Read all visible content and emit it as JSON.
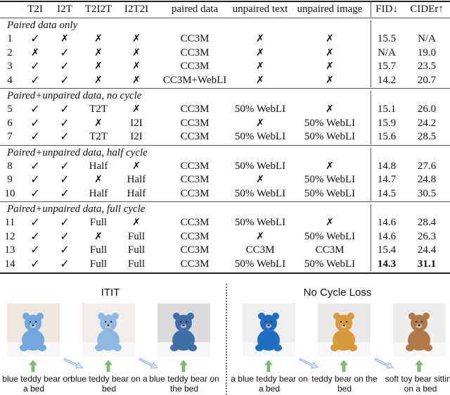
{
  "table": {
    "headers": [
      "",
      "T2I",
      "I2T",
      "T2I2T",
      "I2T2I",
      "paired data",
      "unpaired text",
      "unpaired image",
      "FID↓",
      "CIDEr↑"
    ],
    "sections": [
      {
        "title": "Paired data only",
        "rows": [
          {
            "id": "1",
            "t2i": "✓",
            "i2t": "✗",
            "t2i2t": "✗",
            "i2t2i": "✗",
            "paired": "CC3M",
            "unpaired_text": "✗",
            "unpaired_image": "✗",
            "fid": "15.5",
            "cider": "N/A"
          },
          {
            "id": "2",
            "t2i": "✗",
            "i2t": "✓",
            "t2i2t": "✗",
            "i2t2i": "✗",
            "paired": "CC3M",
            "unpaired_text": "✗",
            "unpaired_image": "✗",
            "fid": "N/A",
            "cider": "19.0"
          },
          {
            "id": "3",
            "t2i": "✓",
            "i2t": "✓",
            "t2i2t": "✗",
            "i2t2i": "✗",
            "paired": "CC3M",
            "unpaired_text": "✗",
            "unpaired_image": "✗",
            "fid": "15.7",
            "cider": "23.5"
          },
          {
            "id": "4",
            "t2i": "✓",
            "i2t": "✓",
            "t2i2t": "✗",
            "i2t2i": "✗",
            "paired": "CC3M+WebLI",
            "unpaired_text": "✗",
            "unpaired_image": "✗",
            "fid": "14.2",
            "cider": "20.7"
          }
        ]
      },
      {
        "title": "Paired+unpaired data, no cycle",
        "rows": [
          {
            "id": "5",
            "t2i": "✓",
            "i2t": "✓",
            "t2i2t": "T2T",
            "i2t2i": "✗",
            "paired": "CC3M",
            "unpaired_text": "50% WebLI",
            "unpaired_image": "✗",
            "fid": "15.1",
            "cider": "26.0"
          },
          {
            "id": "6",
            "t2i": "✓",
            "i2t": "✓",
            "t2i2t": "✗",
            "i2t2i": "I2I",
            "paired": "CC3M",
            "unpaired_text": "✗",
            "unpaired_image": "50% WebLI",
            "fid": "15.9",
            "cider": "24.2"
          },
          {
            "id": "7",
            "t2i": "✓",
            "i2t": "✓",
            "t2i2t": "T2T",
            "i2t2i": "I2I",
            "paired": "CC3M",
            "unpaired_text": "50% WebLI",
            "unpaired_image": "50% WebLI",
            "fid": "15.6",
            "cider": "28.5"
          }
        ]
      },
      {
        "title": "Paired+unpaired data, half cycle",
        "rows": [
          {
            "id": "8",
            "t2i": "✓",
            "i2t": "✓",
            "t2i2t": "Half",
            "i2t2i": "✗",
            "paired": "CC3M",
            "unpaired_text": "50% WebLI",
            "unpaired_image": "✗",
            "fid": "14.8",
            "cider": "27.6"
          },
          {
            "id": "9",
            "t2i": "✓",
            "i2t": "✓",
            "t2i2t": "✗",
            "i2t2i": "Half",
            "paired": "CC3M",
            "unpaired_text": "✗",
            "unpaired_image": "50% WebLI",
            "fid": "14.7",
            "cider": "24.8"
          },
          {
            "id": "10",
            "t2i": "✓",
            "i2t": "✓",
            "t2i2t": "Half",
            "i2t2i": "Half",
            "paired": "CC3M",
            "unpaired_text": "50% WebLI",
            "unpaired_image": "50% WebLI",
            "fid": "14.5",
            "cider": "30.5"
          }
        ]
      },
      {
        "title": "Paired+unpaired data, full cycle",
        "rows": [
          {
            "id": "11",
            "t2i": "✓",
            "i2t": "✓",
            "t2i2t": "Full",
            "i2t2i": "✗",
            "paired": "CC3M",
            "unpaired_text": "50% WebLI",
            "unpaired_image": "✗",
            "fid": "14.6",
            "cider": "28.4"
          },
          {
            "id": "12",
            "t2i": "✓",
            "i2t": "✓",
            "t2i2t": "✗",
            "i2t2i": "Full",
            "paired": "CC3M",
            "unpaired_text": "✗",
            "unpaired_image": "50% WebLI",
            "fid": "14.6",
            "cider": "26.3"
          },
          {
            "id": "13",
            "t2i": "✓",
            "i2t": "✓",
            "t2i2t": "Full",
            "i2t2i": "Full",
            "paired": "CC3M",
            "unpaired_text": "CC3M",
            "unpaired_image": "CC3M",
            "fid": "15.4",
            "cider": "24.4"
          },
          {
            "id": "14",
            "t2i": "✓",
            "i2t": "✓",
            "t2i2t": "Full",
            "i2t2i": "Full",
            "paired": "CC3M",
            "unpaired_text": "50% WebLI",
            "unpaired_image": "50% WebLI",
            "fid": "14.3",
            "cider": "31.1",
            "bold_metrics": true
          }
        ]
      }
    ]
  },
  "figure": {
    "panels": [
      {
        "title": "ITIT",
        "images": [
          {
            "desc": "light blue teddy bear on bed",
            "bear": "#6fa7de",
            "bg": "#efe6dc"
          },
          {
            "desc": "pale blue teddy bear on bed",
            "bear": "#8fb8e3",
            "bg": "#f1ede8"
          },
          {
            "desc": "dark blue teddy bear on bed",
            "bear": "#3f6fa8",
            "bg": "#dcdcdc"
          }
        ],
        "captions": [
          "a blue teddy bear on a bed",
          "blue teddy bear on a bed",
          "blue teddy bear on the bed"
        ]
      },
      {
        "title": "No Cycle Loss",
        "images": [
          {
            "desc": "bright blue teddy bear on bed",
            "bear": "#1f6fc4",
            "bg": "#eeeeee"
          },
          {
            "desc": "orange teddy bear on bed",
            "bear": "#d99a3a",
            "bg": "#eae8e6"
          },
          {
            "desc": "brown soft toy bear sitting on bed",
            "bear": "#b07a48",
            "bg": "#ededec"
          }
        ],
        "captions": [
          "a blue teddy bear on a bed",
          "teddy bear on the bed",
          "soft toy bear sitting on a bed"
        ]
      }
    ],
    "colors": {
      "up_arrow": "#7cc26b",
      "diag_arrow": "#8fb3e6"
    }
  }
}
